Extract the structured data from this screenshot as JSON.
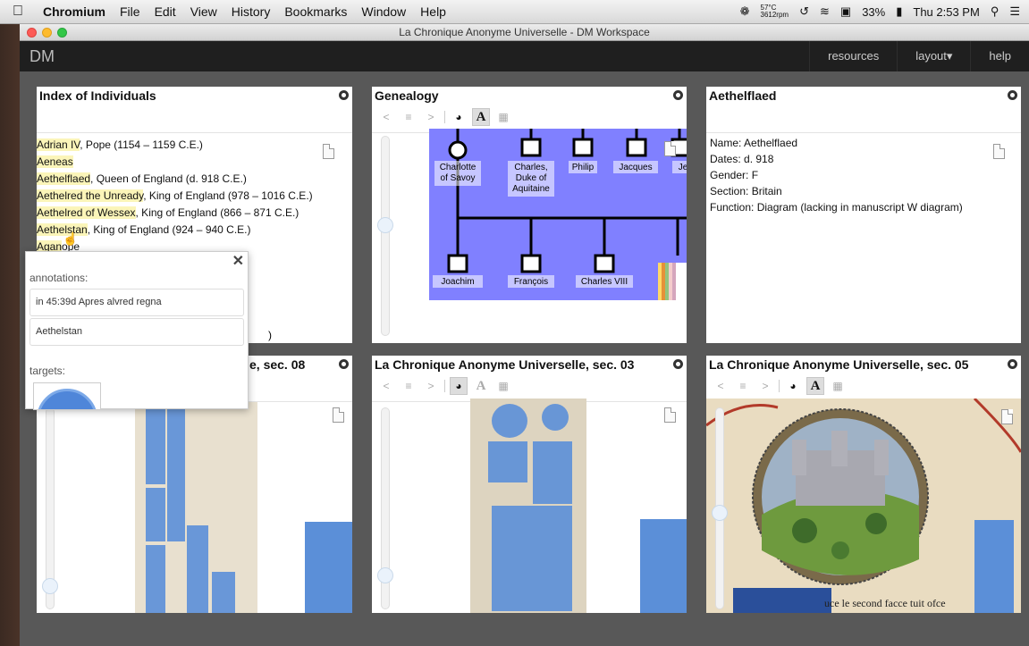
{
  "menubar": {
    "apple": "",
    "items": [
      "Chromium",
      "File",
      "Edit",
      "View",
      "History",
      "Bookmarks",
      "Window",
      "Help"
    ],
    "temp": "57°C",
    "rpm": "3612rpm",
    "battery": "33%",
    "clock": "Thu 2:53 PM"
  },
  "window": {
    "title": "La Chronique Anonyme Universelle - DM Workspace"
  },
  "navbar": {
    "brand": "DM",
    "links": [
      "resources",
      "layout▾",
      "help"
    ]
  },
  "panels": {
    "index": {
      "title": "Index of Individuals",
      "entries": [
        {
          "name": "Adrian IV",
          "rest": ", Pope (1154 – 1159 C.E.)"
        },
        {
          "name": "Aeneas",
          "rest": ""
        },
        {
          "name": "Aethelflaed",
          "rest": ", Queen of England (d. 918 C.E.)"
        },
        {
          "name": "Aethelred the Unready",
          "rest": ", King of England (978 – 1016 C.E.)"
        },
        {
          "name": "Aethelred of Wessex",
          "rest": ", King of England (866 – 871 C.E.)"
        },
        {
          "name": "Aethelstan",
          "rest": ", King of England (924 – 940 C.E.)"
        },
        {
          "name": "Agan",
          "rest": "ope"
        }
      ],
      "trailing": ")"
    },
    "genealogy": {
      "title": "Genealogy",
      "top_names": [
        "Charlotte of Savoy",
        "Charles, Duke of Aquitaine",
        "Philip",
        "Jacques",
        "Je"
      ],
      "bottom_names": [
        "Joachim",
        "François",
        "Charles VIII"
      ]
    },
    "details": {
      "title": "Aethelflaed",
      "lines": [
        "Name: Aethelflaed",
        "Dates: d. 918",
        "Gender: F",
        "Section: Britain",
        "Function: Diagram (lacking in manuscript W diagram)"
      ]
    },
    "sec08": {
      "title": "La Chronique Anonyme Universelle, sec. 08",
      "visible_title": "e, sec. 08"
    },
    "sec03": {
      "title": "La Chronique Anonyme Universelle, sec. 03"
    },
    "sec05": {
      "title": "La Chronique Anonyme Universelle, sec. 05",
      "caption": "uce le second facce tuit ofce"
    }
  },
  "popup": {
    "annotations_label": "annotations:",
    "annotation_1": "in 45:39d Apres alvred regna",
    "annotation_2": "Aethelstan",
    "targets_label": "targets:",
    "close": "✕"
  },
  "toolbar": {
    "prev": "<",
    "list": "≡",
    "next": ">",
    "text": "A"
  },
  "colors": {
    "highlight": "#fbf5b9",
    "genealogy_bg": "#8080ff",
    "annotation_blue": "#5b8fd8",
    "navbar": "#1f1f1f"
  }
}
